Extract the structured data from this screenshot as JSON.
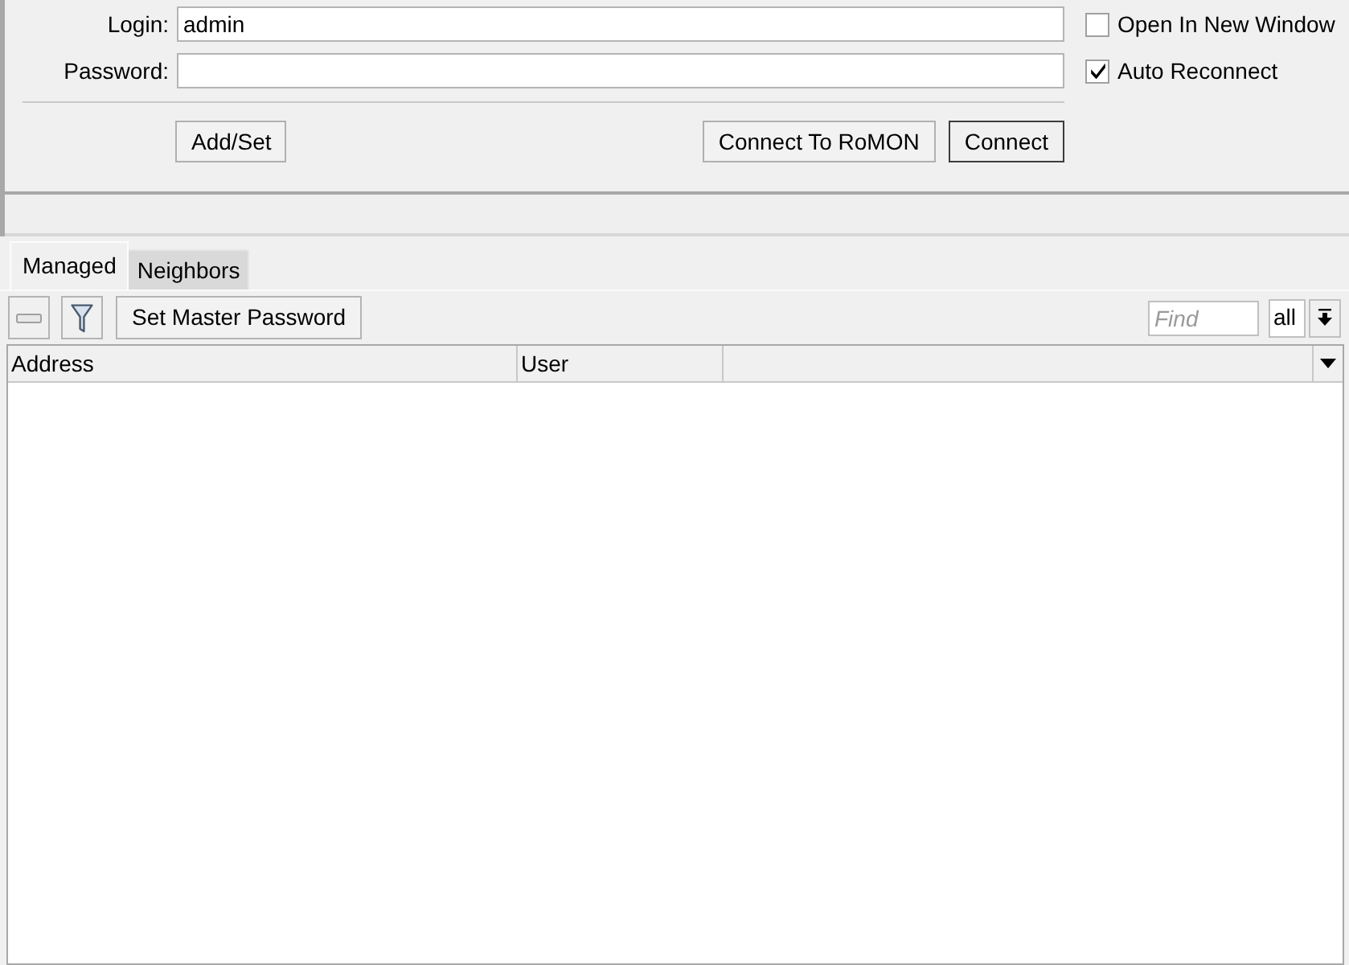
{
  "login_form": {
    "fields": [
      {
        "label": "Login:",
        "value": "admin"
      },
      {
        "label": "Password:"
      }
    ],
    "options": [
      {
        "label": "Open In New Window",
        "checked": false
      },
      {
        "label": "Auto Reconnect",
        "checked": true
      }
    ],
    "buttons": [
      {
        "label": "Add/Set",
        "default": false
      },
      {
        "label": "Connect To RoMON",
        "default": false
      },
      {
        "label": "Connect",
        "default": true
      }
    ]
  },
  "tabs": [
    {
      "label": "Managed",
      "selected": true
    },
    {
      "label": "Neighbors",
      "selected": false
    }
  ],
  "toolbar": {
    "buttons": [
      {
        "label": "Set Master Password"
      }
    ],
    "find": {
      "placeholder": "Find"
    },
    "filter_select": {
      "value": "all"
    }
  },
  "table": {
    "columns": [
      "Address",
      "User"
    ]
  }
}
